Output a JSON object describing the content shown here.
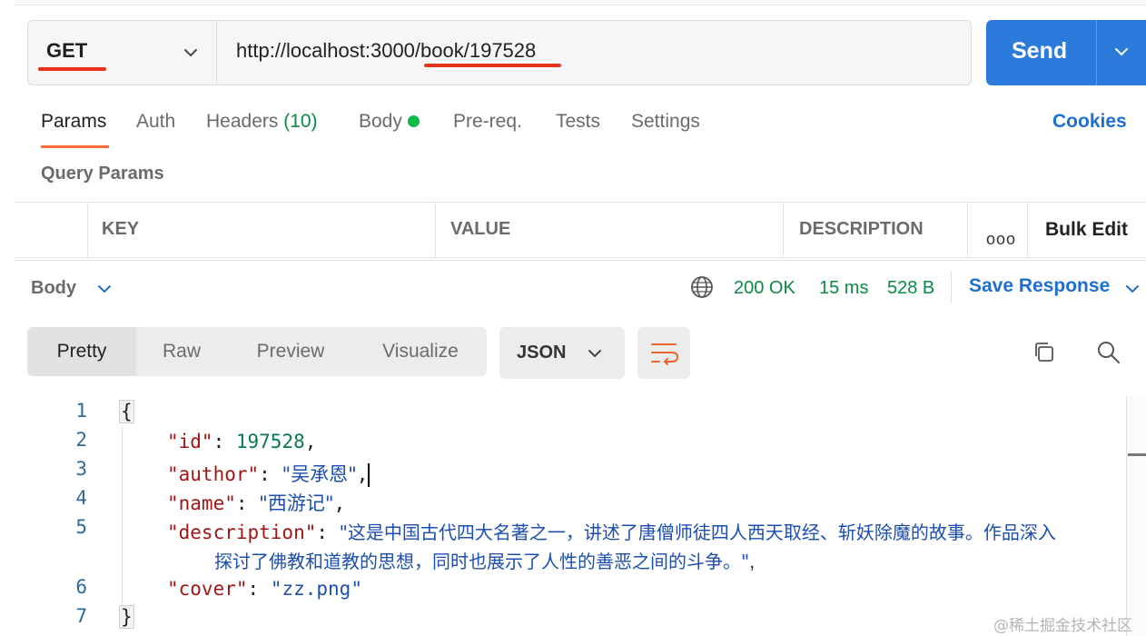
{
  "request": {
    "method": "GET",
    "url": "http://localhost:3000/book/197528",
    "send_label": "Send"
  },
  "tabs": [
    {
      "label": "Params"
    },
    {
      "label": "Auth"
    },
    {
      "label": "Headers",
      "count": "(10)"
    },
    {
      "label": "Body"
    },
    {
      "label": "Pre-req."
    },
    {
      "label": "Tests"
    },
    {
      "label": "Settings"
    }
  ],
  "cookies_label": "Cookies",
  "query_params": {
    "title": "Query Params",
    "columns": [
      "KEY",
      "VALUE",
      "DESCRIPTION"
    ],
    "bulk_edit": "Bulk Edit",
    "more_icon": "ooo"
  },
  "response": {
    "body_label": "Body",
    "status": "200 OK",
    "time": "15 ms",
    "size": "528 B",
    "save_label": "Save Response",
    "views": [
      "Pretty",
      "Raw",
      "Preview",
      "Visualize"
    ],
    "format": "JSON"
  },
  "code": {
    "line_numbers": [
      "1",
      "2",
      "3",
      "4",
      "5",
      "6",
      "7"
    ],
    "open_brace": "{",
    "close_brace": "}",
    "id_key": "\"id\"",
    "id_value": "197528",
    "author_key": "\"author\"",
    "author_value": "\"吴承恩\"",
    "name_key": "\"name\"",
    "name_value": "\"西游记\"",
    "description_key": "\"description\"",
    "description_value_line1": "\"这是中国古代四大名著之一，讲述了唐僧师徒四人西天取经、斩妖除魔的故事。作品深入",
    "description_value_line2": "探讨了佛教和道教的思想，同时也展示了人性的善恶之间的斗争。\"",
    "cover_key": "\"cover\"",
    "cover_value": "\"zz.png\""
  },
  "watermark": "@稀土掘金技术社区",
  "colors": {
    "accent_orange": "#ff6c37",
    "send_blue": "#2b7bdc",
    "link_blue": "#1f6fd0",
    "status_green": "#0a8a45",
    "annotation_red": "#e8311f"
  }
}
